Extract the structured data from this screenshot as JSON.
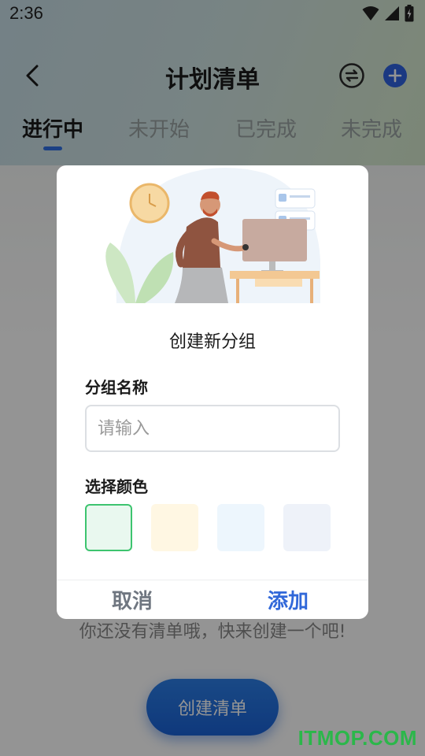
{
  "status_bar": {
    "time": "2:36"
  },
  "header": {
    "title": "计划清单"
  },
  "tabs": [
    {
      "label": "进行中"
    },
    {
      "label": "未开始"
    },
    {
      "label": "已完成"
    },
    {
      "label": "未完成"
    }
  ],
  "empty_state": {
    "text": "你还没有清单哦，快来创建一个吧!"
  },
  "create_button": {
    "label": "创建清单"
  },
  "watermark": {
    "text": "ITMOP.COM"
  },
  "dialog": {
    "title": "创建新分组",
    "name_label": "分组名称",
    "name_input": {
      "placeholder": "请输入",
      "value": ""
    },
    "color_label": "选择颜色",
    "colors": [
      "#e9f8ef",
      "#fff7e3",
      "#edf6fd",
      "#eef2f9"
    ],
    "selected_color_index": 0,
    "cancel_label": "取消",
    "confirm_label": "添加"
  },
  "theme": {
    "accent": "#2f6fe4",
    "selected_border": "#3dc46f",
    "watermark": "#2bb74a"
  }
}
